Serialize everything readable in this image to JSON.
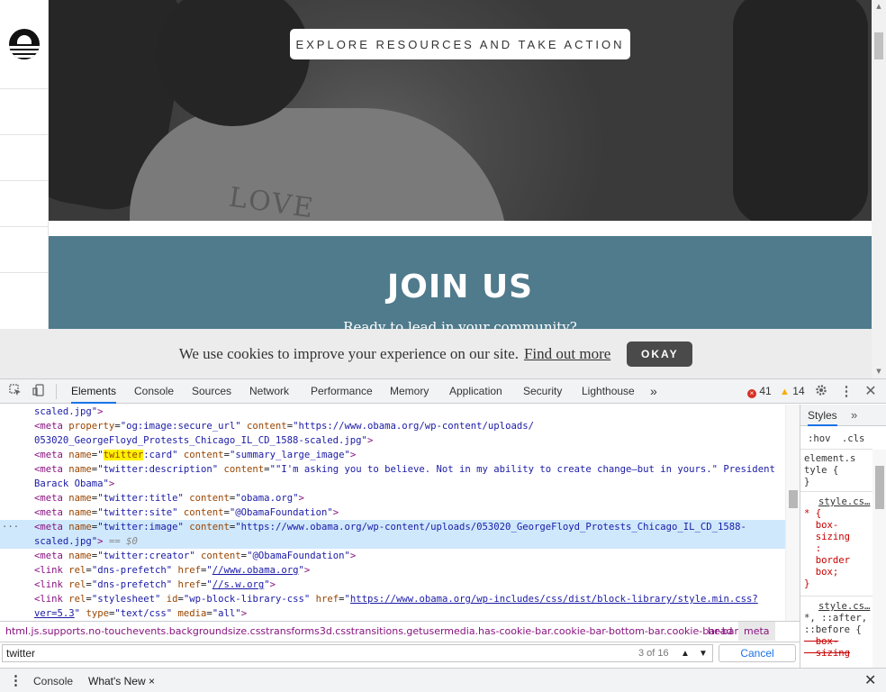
{
  "page": {
    "explore_button": "EXPLORE RESOURCES AND TAKE ACTION",
    "hero_shirt_text": "LOVE",
    "join_title": "JOIN US",
    "join_subtitle": "Ready to lead in your community?",
    "cookie": {
      "message": "We use cookies to improve your experience on our site.",
      "link": "Find out more",
      "okay": "OKAY"
    }
  },
  "devtools": {
    "tabs": [
      "Elements",
      "Console",
      "Sources",
      "Network",
      "Performance",
      "Memory",
      "Application",
      "Security",
      "Lighthouse"
    ],
    "more_tabs": "»",
    "error_count": "41",
    "warning_count": "14",
    "lines": [
      {
        "t": "    scaled.jpg\">"
      },
      {
        "t": "<meta property=\"og:image:secure_url\" content=\"https://www.obama.org/wp-content/uploads/"
      },
      {
        "t": "    053020_GeorgeFloyd_Protests_Chicago_IL_CD_1588-scaled.jpg\">"
      },
      {
        "t": "<meta name=\"twitter:card\" content=\"summary_large_image\">"
      },
      {
        "t": "<meta name=\"twitter:description\" content=\"\"I'm asking you to believe. Not in my ability to create change—but in yours.\" President"
      },
      {
        "t": "    Barack Obama\">"
      },
      {
        "t": "<meta name=\"twitter:title\" content=\"obama.org\">"
      },
      {
        "t": "<meta name=\"twitter:site\" content=\"@ObamaFoundation\">"
      },
      {
        "t": "<meta name=\"twitter:image\" content=\"https://www.obama.org/wp-content/uploads/053020_GeorgeFloyd_Protests_Chicago_IL_CD_1588-"
      },
      {
        "t": "    scaled.jpg\"> == $0"
      },
      {
        "t": "<meta name=\"twitter:creator\" content=\"@ObamaFoundation\">"
      },
      {
        "t": "<link rel=\"dns-prefetch\" href=\"//www.obama.org\">"
      },
      {
        "t": "<link rel=\"dns-prefetch\" href=\"//s.w.org\">"
      },
      {
        "t": "<link rel=\"stylesheet\" id=\"wp-block-library-css\" href=\"https://www.obama.org/wp-includes/css/dist/block-library/style.min.css?"
      },
      {
        "t": "    ver=5.3\" type=\"text/css\" media=\"all\">"
      }
    ],
    "styles": {
      "tab": "Styles",
      "more": "»",
      "filter_hov": ":hov",
      "filter_cls": ".cls",
      "element_style": "element.s\ntyle {\n}",
      "rule1_src": "style.cs…",
      "rule1_body": "* {\n  box-\n  sizing\n  :\n  border\n  box;\n}",
      "rule2_src": "style.cs…",
      "rule2_sel": "*, ::after,\n::before {",
      "rule2_prop": "  box-\n  sizing"
    },
    "breadcrumb": {
      "html": "html.js.supports.no-touchevents.backgroundsize.csstransforms3d.csstransitions.getusermedia.has-cookie-bar.cookie-bar-bottom-bar.cookie-bar-bar",
      "head": "head",
      "meta": "meta"
    },
    "search": {
      "value": "twitter",
      "count": "3 of 16",
      "cancel": "Cancel"
    },
    "drawer": {
      "tabs": [
        "Console",
        "What's New"
      ],
      "close_glyph": "×"
    }
  },
  "icons": [
    "inspect-icon",
    "device-toggle-icon",
    "settings-gear-icon",
    "kebab-menu-icon",
    "close-icon"
  ],
  "colors": {
    "join_bg": "#4f7b8c",
    "tag": "#881280",
    "attr_name": "#994500",
    "attr_value": "#1a1aa6",
    "selected_row": "#cfe8fc",
    "search_highlight": "#fff200",
    "accent": "#1a73e8"
  }
}
